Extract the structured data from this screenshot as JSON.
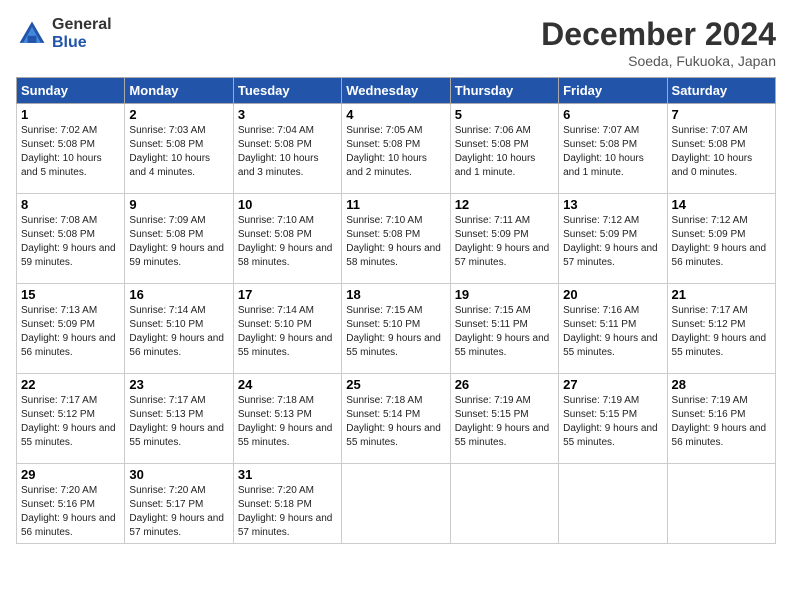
{
  "header": {
    "logo_general": "General",
    "logo_blue": "Blue",
    "month": "December 2024",
    "location": "Soeda, Fukuoka, Japan"
  },
  "weekdays": [
    "Sunday",
    "Monday",
    "Tuesday",
    "Wednesday",
    "Thursday",
    "Friday",
    "Saturday"
  ],
  "weeks": [
    [
      {
        "day": "1",
        "sunrise": "7:02 AM",
        "sunset": "5:08 PM",
        "daylight": "10 hours and 5 minutes."
      },
      {
        "day": "2",
        "sunrise": "7:03 AM",
        "sunset": "5:08 PM",
        "daylight": "10 hours and 4 minutes."
      },
      {
        "day": "3",
        "sunrise": "7:04 AM",
        "sunset": "5:08 PM",
        "daylight": "10 hours and 3 minutes."
      },
      {
        "day": "4",
        "sunrise": "7:05 AM",
        "sunset": "5:08 PM",
        "daylight": "10 hours and 2 minutes."
      },
      {
        "day": "5",
        "sunrise": "7:06 AM",
        "sunset": "5:08 PM",
        "daylight": "10 hours and 1 minute."
      },
      {
        "day": "6",
        "sunrise": "7:07 AM",
        "sunset": "5:08 PM",
        "daylight": "10 hours and 1 minute."
      },
      {
        "day": "7",
        "sunrise": "7:07 AM",
        "sunset": "5:08 PM",
        "daylight": "10 hours and 0 minutes."
      }
    ],
    [
      {
        "day": "8",
        "sunrise": "7:08 AM",
        "sunset": "5:08 PM",
        "daylight": "9 hours and 59 minutes."
      },
      {
        "day": "9",
        "sunrise": "7:09 AM",
        "sunset": "5:08 PM",
        "daylight": "9 hours and 59 minutes."
      },
      {
        "day": "10",
        "sunrise": "7:10 AM",
        "sunset": "5:08 PM",
        "daylight": "9 hours and 58 minutes."
      },
      {
        "day": "11",
        "sunrise": "7:10 AM",
        "sunset": "5:08 PM",
        "daylight": "9 hours and 58 minutes."
      },
      {
        "day": "12",
        "sunrise": "7:11 AM",
        "sunset": "5:09 PM",
        "daylight": "9 hours and 57 minutes."
      },
      {
        "day": "13",
        "sunrise": "7:12 AM",
        "sunset": "5:09 PM",
        "daylight": "9 hours and 57 minutes."
      },
      {
        "day": "14",
        "sunrise": "7:12 AM",
        "sunset": "5:09 PM",
        "daylight": "9 hours and 56 minutes."
      }
    ],
    [
      {
        "day": "15",
        "sunrise": "7:13 AM",
        "sunset": "5:09 PM",
        "daylight": "9 hours and 56 minutes."
      },
      {
        "day": "16",
        "sunrise": "7:14 AM",
        "sunset": "5:10 PM",
        "daylight": "9 hours and 56 minutes."
      },
      {
        "day": "17",
        "sunrise": "7:14 AM",
        "sunset": "5:10 PM",
        "daylight": "9 hours and 55 minutes."
      },
      {
        "day": "18",
        "sunrise": "7:15 AM",
        "sunset": "5:10 PM",
        "daylight": "9 hours and 55 minutes."
      },
      {
        "day": "19",
        "sunrise": "7:15 AM",
        "sunset": "5:11 PM",
        "daylight": "9 hours and 55 minutes."
      },
      {
        "day": "20",
        "sunrise": "7:16 AM",
        "sunset": "5:11 PM",
        "daylight": "9 hours and 55 minutes."
      },
      {
        "day": "21",
        "sunrise": "7:17 AM",
        "sunset": "5:12 PM",
        "daylight": "9 hours and 55 minutes."
      }
    ],
    [
      {
        "day": "22",
        "sunrise": "7:17 AM",
        "sunset": "5:12 PM",
        "daylight": "9 hours and 55 minutes."
      },
      {
        "day": "23",
        "sunrise": "7:17 AM",
        "sunset": "5:13 PM",
        "daylight": "9 hours and 55 minutes."
      },
      {
        "day": "24",
        "sunrise": "7:18 AM",
        "sunset": "5:13 PM",
        "daylight": "9 hours and 55 minutes."
      },
      {
        "day": "25",
        "sunrise": "7:18 AM",
        "sunset": "5:14 PM",
        "daylight": "9 hours and 55 minutes."
      },
      {
        "day": "26",
        "sunrise": "7:19 AM",
        "sunset": "5:15 PM",
        "daylight": "9 hours and 55 minutes."
      },
      {
        "day": "27",
        "sunrise": "7:19 AM",
        "sunset": "5:15 PM",
        "daylight": "9 hours and 55 minutes."
      },
      {
        "day": "28",
        "sunrise": "7:19 AM",
        "sunset": "5:16 PM",
        "daylight": "9 hours and 56 minutes."
      }
    ],
    [
      {
        "day": "29",
        "sunrise": "7:20 AM",
        "sunset": "5:16 PM",
        "daylight": "9 hours and 56 minutes."
      },
      {
        "day": "30",
        "sunrise": "7:20 AM",
        "sunset": "5:17 PM",
        "daylight": "9 hours and 57 minutes."
      },
      {
        "day": "31",
        "sunrise": "7:20 AM",
        "sunset": "5:18 PM",
        "daylight": "9 hours and 57 minutes."
      },
      null,
      null,
      null,
      null
    ]
  ]
}
